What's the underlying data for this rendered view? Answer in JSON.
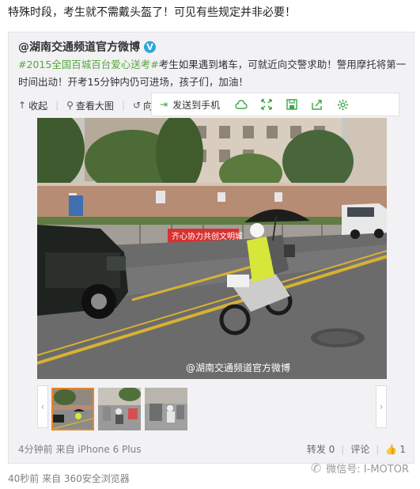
{
  "post": {
    "text": "特殊时段，考生就不需戴头盔了！可见有些规定并非必要！",
    "time_source": "40秒前 来自 360安全浏览器"
  },
  "original": {
    "author": "@湖南交通频道官方微博",
    "verified_badge": "V",
    "topic": "#2015全国百城百台爱心送考#",
    "text": "考生如果遇到堵车，可就近向交警求助！警用摩托将第一时间出动！开考15分钟内仍可进场，孩子们，加油！",
    "time_source": "4分钟前 来自 iPhone 6 Plus"
  },
  "pic_toolbar": {
    "collapse": "收起",
    "view_large": "查看大图",
    "rotate_left": "向左旋转"
  },
  "share_bar": {
    "send_to_phone": "发送到手机",
    "icons": [
      "cloud-icon",
      "expand-icon",
      "save-icon",
      "share-out-icon",
      "settings-icon"
    ]
  },
  "photo": {
    "watermark": "@湖南交通频道官方微博",
    "banner_text": "齐心协力共创文明城"
  },
  "actions": {
    "repost": "转发 0",
    "comment": "评论",
    "like": "1"
  },
  "watermark_footer": "微信号: I-MOTOR",
  "colors": {
    "topic": "#56a63b",
    "share_icon": "#3aa745",
    "verified": "#2aa6e0",
    "thumb_active": "#e8852a"
  }
}
